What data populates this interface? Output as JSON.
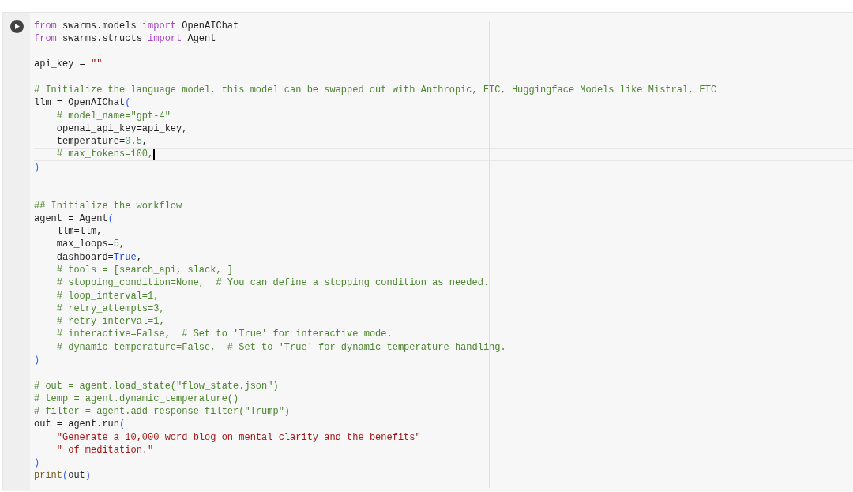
{
  "cell": {
    "lines": [
      {
        "kind": "code",
        "active": false,
        "tokens": [
          {
            "kind": "keyword",
            "text": "from"
          },
          {
            "kind": "plain",
            "text": " swarms.models "
          },
          {
            "kind": "keyword",
            "text": "import"
          },
          {
            "kind": "plain",
            "text": " OpenAIChat"
          }
        ]
      },
      {
        "kind": "code",
        "active": false,
        "tokens": [
          {
            "kind": "keyword",
            "text": "from"
          },
          {
            "kind": "plain",
            "text": " swarms.structs "
          },
          {
            "kind": "keyword",
            "text": "import"
          },
          {
            "kind": "plain",
            "text": " Agent"
          }
        ]
      },
      {
        "kind": "blank"
      },
      {
        "kind": "code",
        "active": false,
        "tokens": [
          {
            "kind": "plain",
            "text": "api_key = "
          },
          {
            "kind": "string",
            "text": "\"\""
          }
        ]
      },
      {
        "kind": "blank"
      },
      {
        "kind": "code",
        "active": false,
        "tokens": [
          {
            "kind": "comment",
            "text": "# Initialize the language model, this model can be swapped out with Anthropic, ETC, Huggingface Models like Mistral, ETC"
          }
        ]
      },
      {
        "kind": "code",
        "active": false,
        "tokens": [
          {
            "kind": "plain",
            "text": "llm = OpenAIChat"
          },
          {
            "kind": "bracket",
            "text": "("
          }
        ]
      },
      {
        "kind": "code",
        "active": false,
        "tokens": [
          {
            "kind": "comment",
            "text": "    # model_name=\"gpt-4\""
          }
        ]
      },
      {
        "kind": "code",
        "active": false,
        "tokens": [
          {
            "kind": "plain",
            "text": "    openai_api_key=api_key,"
          }
        ]
      },
      {
        "kind": "code",
        "active": false,
        "tokens": [
          {
            "kind": "plain",
            "text": "    temperature="
          },
          {
            "kind": "number",
            "text": "0.5"
          },
          {
            "kind": "plain",
            "text": ","
          }
        ]
      },
      {
        "kind": "code",
        "active": true,
        "tokens": [
          {
            "kind": "comment",
            "text": "    # max_tokens=100,"
          }
        ]
      },
      {
        "kind": "code",
        "active": false,
        "tokens": [
          {
            "kind": "bracket",
            "text": ")"
          }
        ]
      },
      {
        "kind": "blank"
      },
      {
        "kind": "blank"
      },
      {
        "kind": "code",
        "active": false,
        "tokens": [
          {
            "kind": "comment",
            "text": "## Initialize the workflow"
          }
        ]
      },
      {
        "kind": "code",
        "active": false,
        "tokens": [
          {
            "kind": "plain",
            "text": "agent = Agent"
          },
          {
            "kind": "bracket",
            "text": "("
          }
        ]
      },
      {
        "kind": "code",
        "active": false,
        "tokens": [
          {
            "kind": "plain",
            "text": "    llm=llm,"
          }
        ]
      },
      {
        "kind": "code",
        "active": false,
        "tokens": [
          {
            "kind": "plain",
            "text": "    max_loops="
          },
          {
            "kind": "number",
            "text": "5"
          },
          {
            "kind": "plain",
            "text": ","
          }
        ]
      },
      {
        "kind": "code",
        "active": false,
        "tokens": [
          {
            "kind": "plain",
            "text": "    dashboard="
          },
          {
            "kind": "constant",
            "text": "True"
          },
          {
            "kind": "plain",
            "text": ","
          }
        ]
      },
      {
        "kind": "code",
        "active": false,
        "tokens": [
          {
            "kind": "comment",
            "text": "    # tools = [search_api, slack, ]"
          }
        ]
      },
      {
        "kind": "code",
        "active": false,
        "tokens": [
          {
            "kind": "comment",
            "text": "    # stopping_condition=None,  # You can define a stopping condition as needed."
          }
        ]
      },
      {
        "kind": "code",
        "active": false,
        "tokens": [
          {
            "kind": "comment",
            "text": "    # loop_interval=1,"
          }
        ]
      },
      {
        "kind": "code",
        "active": false,
        "tokens": [
          {
            "kind": "comment",
            "text": "    # retry_attempts=3,"
          }
        ]
      },
      {
        "kind": "code",
        "active": false,
        "tokens": [
          {
            "kind": "comment",
            "text": "    # retry_interval=1,"
          }
        ]
      },
      {
        "kind": "code",
        "active": false,
        "tokens": [
          {
            "kind": "comment",
            "text": "    # interactive=False,  # Set to 'True' for interactive mode."
          }
        ]
      },
      {
        "kind": "code",
        "active": false,
        "tokens": [
          {
            "kind": "comment",
            "text": "    # dynamic_temperature=False,  # Set to 'True' for dynamic temperature handling."
          }
        ]
      },
      {
        "kind": "code",
        "active": false,
        "tokens": [
          {
            "kind": "bracket",
            "text": ")"
          }
        ]
      },
      {
        "kind": "blank"
      },
      {
        "kind": "code",
        "active": false,
        "tokens": [
          {
            "kind": "comment",
            "text": "# out = agent.load_state(\"flow_state.json\")"
          }
        ]
      },
      {
        "kind": "code",
        "active": false,
        "tokens": [
          {
            "kind": "comment",
            "text": "# temp = agent.dynamic_temperature()"
          }
        ]
      },
      {
        "kind": "code",
        "active": false,
        "tokens": [
          {
            "kind": "comment",
            "text": "# filter = agent.add_response_filter(\"Trump\")"
          }
        ]
      },
      {
        "kind": "code",
        "active": false,
        "tokens": [
          {
            "kind": "plain",
            "text": "out = agent.run"
          },
          {
            "kind": "bracket",
            "text": "("
          }
        ]
      },
      {
        "kind": "code",
        "active": false,
        "tokens": [
          {
            "kind": "string",
            "text": "    \"Generate a 10,000 word blog on mental clarity and the benefits\""
          }
        ]
      },
      {
        "kind": "code",
        "active": false,
        "tokens": [
          {
            "kind": "string",
            "text": "    \" of meditation.\""
          }
        ]
      },
      {
        "kind": "code",
        "active": false,
        "tokens": [
          {
            "kind": "bracket",
            "text": ")"
          }
        ]
      },
      {
        "kind": "code",
        "active": false,
        "tokens": [
          {
            "kind": "builtin",
            "text": "print"
          },
          {
            "kind": "bracket",
            "text": "("
          },
          {
            "kind": "plain",
            "text": "out"
          },
          {
            "kind": "bracket",
            "text": ")"
          }
        ]
      }
    ]
  }
}
